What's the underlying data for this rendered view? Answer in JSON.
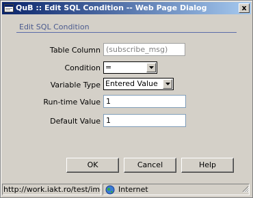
{
  "window": {
    "title": "QuB :: Edit SQL Condition -- Web Page Dialog",
    "close_label": "x"
  },
  "section": {
    "title": "Edit SQL Condition"
  },
  "form": {
    "table_column": {
      "label": "Table Column",
      "value": "(subscribe_msg)"
    },
    "condition": {
      "label": "Condition",
      "value": "="
    },
    "variable_type": {
      "label": "Variable Type",
      "value": "Entered Value"
    },
    "runtime_value": {
      "label": "Run-time Value",
      "value": "1"
    },
    "default_value": {
      "label": "Default Value",
      "value": "1"
    }
  },
  "buttons": {
    "ok": "OK",
    "cancel": "Cancel",
    "help": "Help"
  },
  "statusbar": {
    "url": "http://work.iakt.ro/test/imc/d",
    "zone": "Internet"
  },
  "icons": {
    "title": "dialog-app-icon",
    "close": "close-icon",
    "dropdown": "chevron-down-icon",
    "zone": "globe-icon"
  }
}
